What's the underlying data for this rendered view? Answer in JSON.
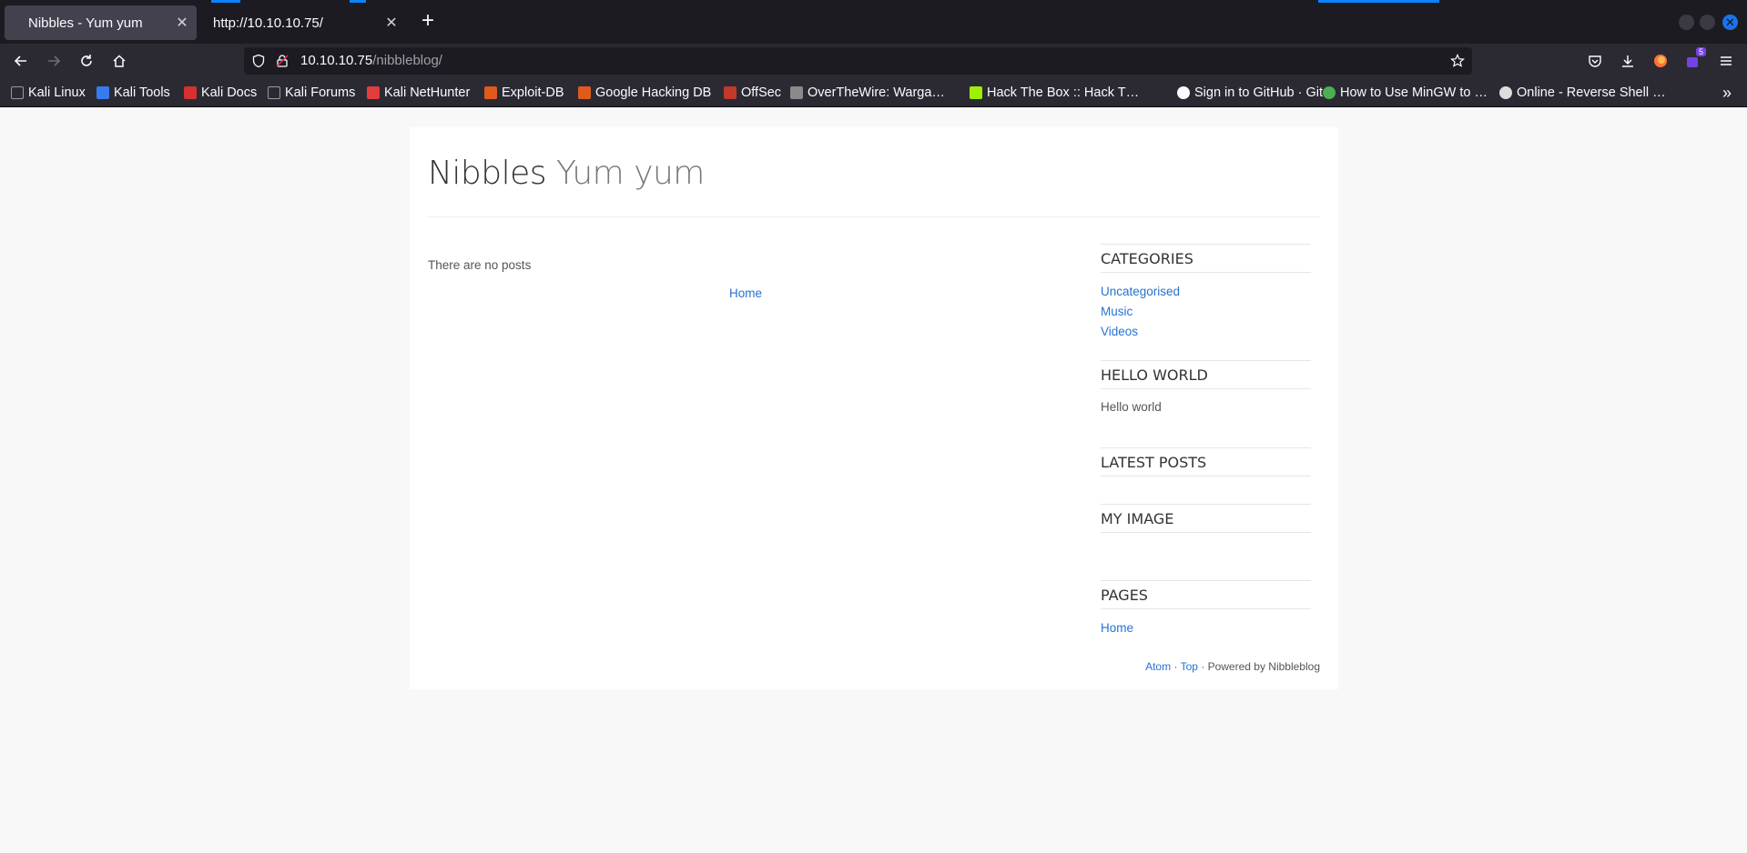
{
  "browser": {
    "tabs": [
      {
        "title": "Nibbles - Yum yum",
        "active": true
      },
      {
        "title": "http://10.10.10.75/",
        "active": false
      }
    ],
    "url": {
      "host": "10.10.10.75",
      "path": "/nibbleblog/"
    },
    "extensions_badge": "5",
    "bookmarks": [
      {
        "label": "Kali Linux",
        "icon": "kali-dragon-icon"
      },
      {
        "label": "Kali Tools",
        "icon": "kali-tools-icon"
      },
      {
        "label": "Kali Docs",
        "icon": "kali-docs-icon"
      },
      {
        "label": "Kali Forums",
        "icon": "kali-forums-icon"
      },
      {
        "label": "Kali NetHunter",
        "icon": "nethunter-icon"
      },
      {
        "label": "Exploit-DB",
        "icon": "exploit-db-icon"
      },
      {
        "label": "Google Hacking DB",
        "icon": "ghdb-icon"
      },
      {
        "label": "OffSec",
        "icon": "offsec-icon"
      },
      {
        "label": "OverTheWire: Warga…",
        "icon": "overthewire-icon"
      },
      {
        "label": "Hack The Box :: Hack T…",
        "icon": "htb-icon"
      },
      {
        "label": "Sign in to GitHub · Git…",
        "icon": "github-icon"
      },
      {
        "label": "How to Use MinGW to …",
        "icon": "mingw-icon"
      },
      {
        "label": "Online - Reverse Shell …",
        "icon": "skull-icon"
      }
    ]
  },
  "blog": {
    "name": "Nibbles",
    "slogan": "Yum yum",
    "no_posts": "There are no posts",
    "home_link": "Home",
    "sidebar": {
      "categories": {
        "title": "CATEGORIES",
        "items": [
          "Uncategorised",
          "Music",
          "Videos"
        ]
      },
      "hello": {
        "title": "HELLO WORLD",
        "text": "Hello world"
      },
      "latest": {
        "title": "LATEST POSTS"
      },
      "image": {
        "title": "MY IMAGE"
      },
      "pages": {
        "title": "PAGES",
        "items": [
          "Home"
        ]
      }
    },
    "footer": {
      "atom": "Atom",
      "sep1": " · ",
      "top": "Top",
      "powered": " · Powered by Nibbleblog"
    }
  },
  "colors": {
    "link": "#2672d2",
    "accent": "#0a84ff"
  }
}
